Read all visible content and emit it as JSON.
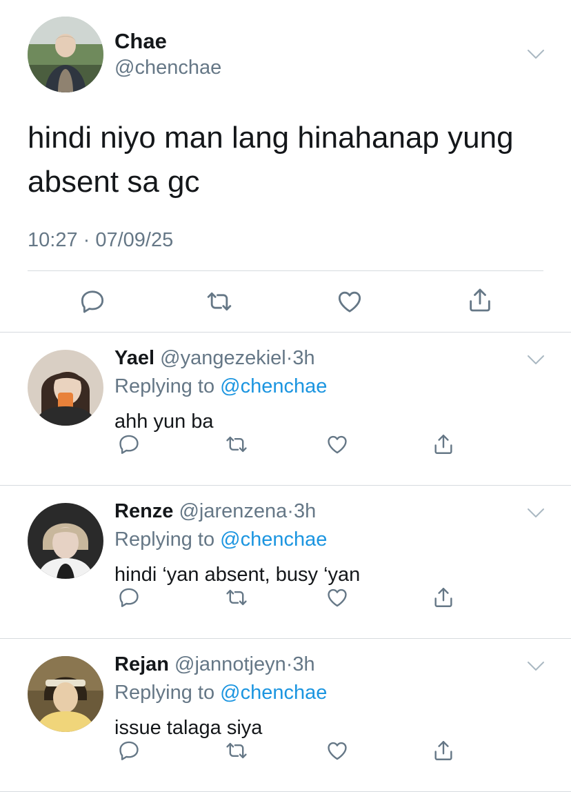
{
  "main_tweet": {
    "name": "Chae",
    "handle": "@chenchae",
    "text": "hindi niyo man lang hinahanap yung absent sa gc",
    "timestamp": "10:27 · 07/09/25",
    "avatar_icon": "profile-photo"
  },
  "replies": [
    {
      "name": "Yael",
      "handle": "@yangezekiel",
      "separator": "·",
      "time": "3h",
      "replying_prefix": "Replying to",
      "replying_to": "@chenchae",
      "text": "ahh yun ba"
    },
    {
      "name": "Renze",
      "handle": "@jarenzena",
      "separator": "·",
      "time": "3h",
      "replying_prefix": "Replying to",
      "replying_to": "@chenchae",
      "text": "hindi ‘yan absent, busy ‘yan"
    },
    {
      "name": "Rejan",
      "handle": "@jannotjeyn",
      "separator": "·",
      "time": "3h",
      "replying_prefix": "Replying to",
      "replying_to": "@chenchae",
      "text": "issue talaga siya"
    }
  ],
  "colors": {
    "text": "#14171a",
    "secondary": "#657786",
    "mention": "#1b95e0",
    "divider": "#d6dade"
  },
  "icons": [
    "reply-icon",
    "retweet-icon",
    "like-icon",
    "share-icon",
    "chevron-down-icon"
  ]
}
